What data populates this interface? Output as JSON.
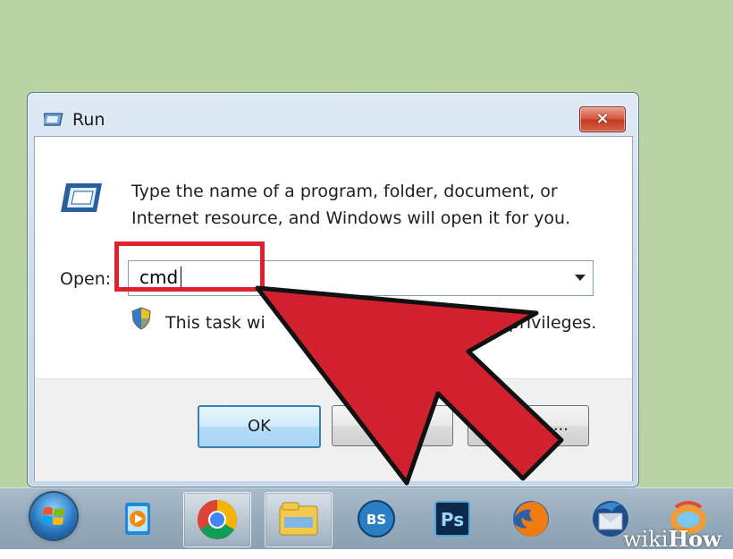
{
  "window": {
    "title": "Run",
    "close_label": "×"
  },
  "dialog": {
    "description_line1": "Type the name of a program, folder, document, or",
    "description_line2": "Internet resource, and Windows will open it for you.",
    "open_label": "Open:",
    "open_value": "cmd",
    "admin_note_start": "This task wi",
    "admin_note_end": "privileges.",
    "ok_label": "OK",
    "browse_label": "..."
  },
  "taskbar": {
    "items": [
      {
        "name": "start-orb-icon"
      },
      {
        "name": "windows-media-player-icon"
      },
      {
        "name": "chrome-icon"
      },
      {
        "name": "windows-explorer-icon"
      },
      {
        "name": "bs-player-icon",
        "label": "BS"
      },
      {
        "name": "photoshop-icon",
        "label": "Ps"
      },
      {
        "name": "firefox-icon"
      },
      {
        "name": "thunderbird-icon"
      },
      {
        "name": "rocketdock-icon"
      }
    ]
  },
  "watermark": {
    "text_wiki": "wiki",
    "text_how": "How"
  },
  "colors": {
    "highlight": "#e2212e",
    "arrow_fill": "#d1202e",
    "background": "#b9d3a3"
  }
}
